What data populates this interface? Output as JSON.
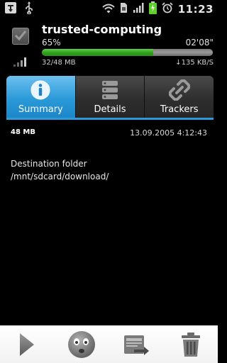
{
  "status_bar": {
    "time": "11:23",
    "icons": [
      "app-badge-icon",
      "usb-icon",
      "wifi-icon",
      "sim-icon",
      "signal-bars-icon",
      "battery-charging-icon",
      "alarm-icon"
    ]
  },
  "torrent": {
    "name": "trusted-computing",
    "percent_text": "65%",
    "progress": 0.65,
    "eta": "02'08\"",
    "size_text": "32/48 MB",
    "speed_text": "↓135 KB/S",
    "colors": {
      "progress_fill": "#3fb528",
      "progress_track": "#8a8a8a"
    }
  },
  "tabs": [
    {
      "label": "Summary",
      "icon": "info-icon",
      "active": true
    },
    {
      "label": "Details",
      "icon": "list-icon",
      "active": false
    },
    {
      "label": "Trackers",
      "icon": "link-icon",
      "active": false
    }
  ],
  "accent_color": "#2b9ad8",
  "summary": {
    "size": "48 MB",
    "date": "13.09.2005 4:12:43",
    "destination_title": "Destination folder",
    "destination_path": "/mnt/sdcard/download/"
  },
  "toolbar": {
    "buttons": [
      "play-icon",
      "sad-face-icon",
      "move-file-icon",
      "trash-icon"
    ]
  }
}
